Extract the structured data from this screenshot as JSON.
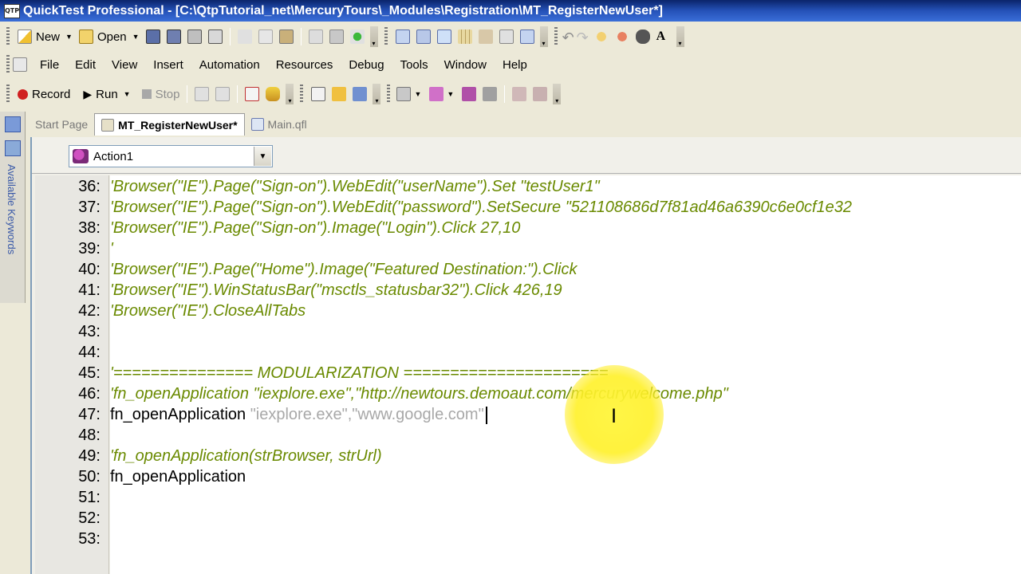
{
  "window": {
    "title": "QuickTest Professional - [C:\\QtpTutorial_net\\MercuryTours\\_Modules\\Registration\\MT_RegisterNewUser*]",
    "app_icon_text": "QTP"
  },
  "toolbar1": {
    "new_label": "New",
    "open_label": "Open"
  },
  "menu": [
    "File",
    "Edit",
    "View",
    "Insert",
    "Automation",
    "Resources",
    "Debug",
    "Tools",
    "Window",
    "Help"
  ],
  "toolbar2": {
    "record_label": "Record",
    "run_label": "Run",
    "stop_label": "Stop"
  },
  "sidebar": {
    "label": "Available Keywords"
  },
  "tabs": [
    {
      "label": "Start Page",
      "active": false
    },
    {
      "label": "MT_RegisterNewUser*",
      "active": true
    },
    {
      "label": "Main.qfl",
      "active": false
    }
  ],
  "action_selector": {
    "value": "Action1"
  },
  "code_lines": [
    {
      "num": "36:",
      "text": "'Browser(\"IE\").Page(\"Sign-on\").WebEdit(\"userName\").Set \"testUser1\"",
      "kind": "comment"
    },
    {
      "num": "37:",
      "text": "'Browser(\"IE\").Page(\"Sign-on\").WebEdit(\"password\").SetSecure \"521108686d7f81ad46a6390c6e0cf1e32",
      "kind": "comment"
    },
    {
      "num": "38:",
      "text": "'Browser(\"IE\").Page(\"Sign-on\").Image(\"Login\").Click 27,10",
      "kind": "comment"
    },
    {
      "num": "39:",
      "text": "'",
      "kind": "comment"
    },
    {
      "num": "40:",
      "text": "'Browser(\"IE\").Page(\"Home\").Image(\"Featured Destination:\").Click",
      "kind": "comment"
    },
    {
      "num": "41:",
      "text": "'Browser(\"IE\").WinStatusBar(\"msctls_statusbar32\").Click 426,19",
      "kind": "comment"
    },
    {
      "num": "42:",
      "text": "'Browser(\"IE\").CloseAllTabs",
      "kind": "comment"
    },
    {
      "num": "43:",
      "text": "",
      "kind": "plain"
    },
    {
      "num": "44:",
      "text": "",
      "kind": "plain"
    },
    {
      "num": "45:",
      "text": "'=============== MODULARIZATION ======================",
      "kind": "comment"
    },
    {
      "num": "46:",
      "text": "'fn_openApplication \"iexplore.exe\",\"http://newtours.demoaut.com/mercurywelcome.php\"",
      "kind": "comment"
    },
    {
      "num": "47:",
      "text": "fn_openApplication ",
      "kind": "plain",
      "extra": "\"iexplore.exe\",\"www.google.com\""
    },
    {
      "num": "48:",
      "text": "",
      "kind": "plain"
    },
    {
      "num": "49:",
      "text": "'fn_openApplication(strBrowser, strUrl)",
      "kind": "comment"
    },
    {
      "num": "50:",
      "text": "fn_openApplication",
      "kind": "plain"
    },
    {
      "num": "51:",
      "text": "",
      "kind": "plain"
    },
    {
      "num": "52:",
      "text": "",
      "kind": "plain"
    },
    {
      "num": "53:",
      "text": "",
      "kind": "plain"
    }
  ],
  "colors": {
    "comment": "#6a8a00",
    "string_dim": "#a8a8a8",
    "title_bar": "#0a246a",
    "highlight": "#fff23c"
  }
}
